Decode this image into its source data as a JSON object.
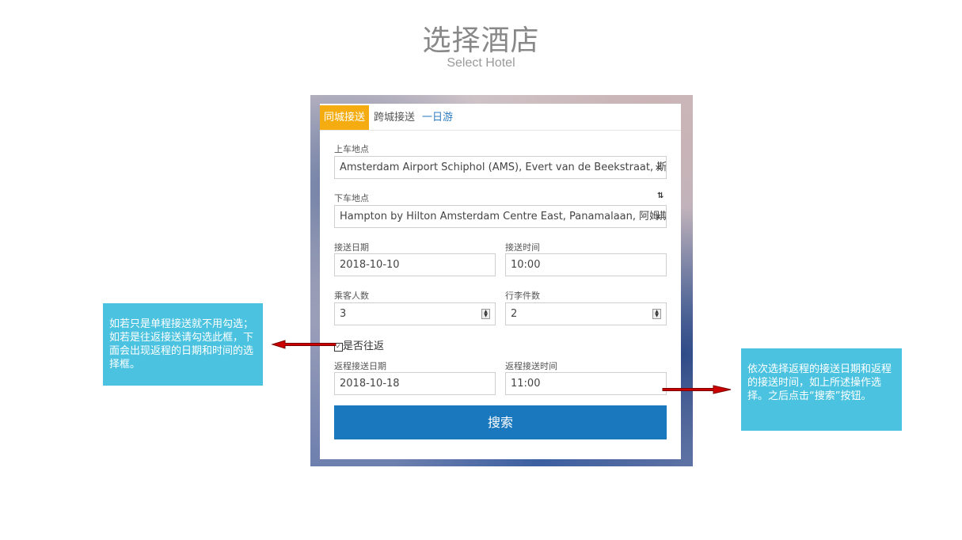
{
  "header": {
    "title": "选择酒店",
    "subtitle": "Select Hotel"
  },
  "tabs": [
    {
      "label": "同城接送",
      "active": true
    },
    {
      "label": "跨城接送",
      "active": false
    },
    {
      "label": "一日游",
      "active": false
    }
  ],
  "form": {
    "pickup_label": "上车地点",
    "pickup_value": "Amsterdam Airport Schiphol (AMS), Evert van de Beekstraat, 斯希普霍尔",
    "dropoff_label": "下车地点",
    "dropoff_value": "Hampton by Hilton Amsterdam Centre East, Panamalaan, 阿姆斯特丹荷兰",
    "swap_icon": "⇅",
    "clear_icon": "×",
    "date_label": "接送日期",
    "date_value": "2018-10-10",
    "time_label": "接送时间",
    "time_value": "10:00",
    "passengers_label": "乘客人数",
    "passengers_value": "3",
    "luggage_label": "行李件数",
    "luggage_value": "2",
    "roundtrip_label": "是否往返",
    "roundtrip_checked": true,
    "return_date_label": "返程接送日期",
    "return_date_value": "2018-10-18",
    "return_time_label": "返程接送时间",
    "return_time_value": "11:00",
    "search_label": "搜索"
  },
  "notes": {
    "left": "如若只是单程接送就不用勾选；如若是往返接送请勾选此框，下面会出现返程的日期和时间的选择框。",
    "right": "依次选择返程的接送日期和返程的接送时间，如上所述操作选择。之后点击“搜索”按钮。"
  },
  "colors": {
    "tab_active": "#f4ac10",
    "search_button": "#1a78bf",
    "note_bg": "#4bc3e0",
    "arrow": "#cc0000"
  }
}
